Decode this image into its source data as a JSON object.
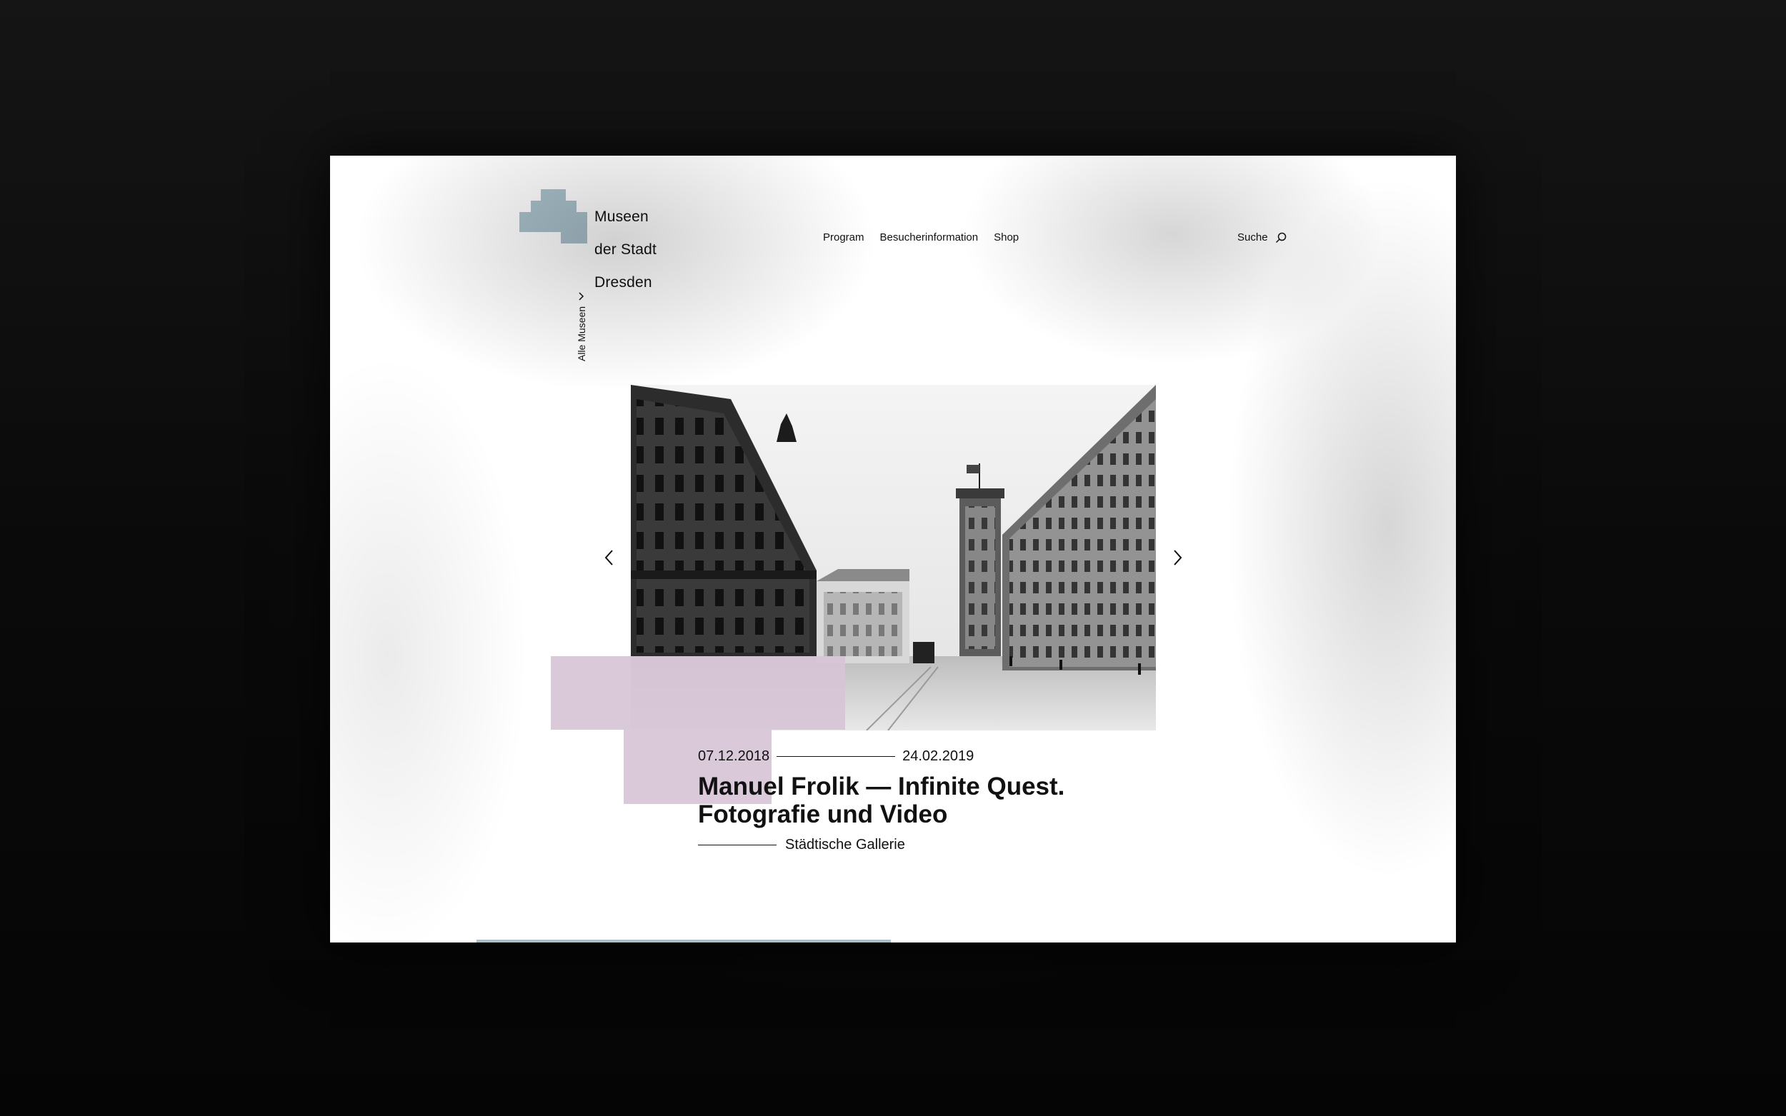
{
  "logo": {
    "line1": "Museen",
    "line2": "der Stadt",
    "line3": "Dresden",
    "color": "#a9c0cb"
  },
  "nav": {
    "items": [
      "Program",
      "Besucherinformation",
      "Shop"
    ]
  },
  "search": {
    "label": "Suche",
    "icon": "search-icon"
  },
  "museum_switcher": {
    "label": "Alle Museen",
    "icon": "chevron-down-icon"
  },
  "slide": {
    "start_date": "07.12.2018",
    "end_date": "24.02.2019",
    "title_line1": "Manuel Frolik — Infinite Quest.",
    "title_line2": "Fotografie und Video",
    "venue": "Städtische Gallerie",
    "accent_color": "#d6c4d6",
    "prev_icon": "chevron-left-icon",
    "next_icon": "chevron-right-icon"
  }
}
